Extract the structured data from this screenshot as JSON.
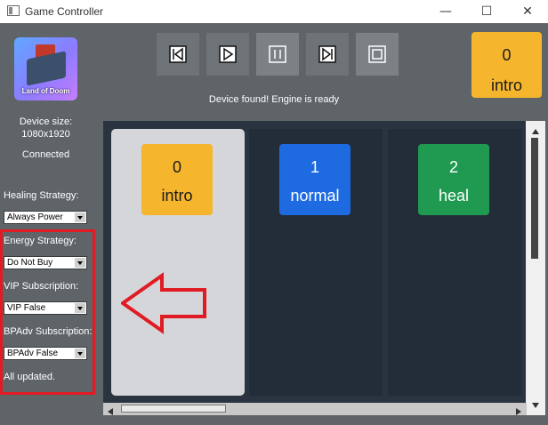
{
  "window": {
    "title": "Game Controller",
    "minimize_glyph": "—",
    "maximize_glyph": "☐",
    "close_glyph": "✕"
  },
  "logo": {
    "text": "Land of Doom",
    "icon": "game-logo"
  },
  "controls": [
    {
      "name": "skip-to-start-button",
      "icon": "skip-back-icon",
      "enabled": true
    },
    {
      "name": "play-button",
      "icon": "play-icon",
      "enabled": true
    },
    {
      "name": "pause-button",
      "icon": "pause-icon",
      "enabled": false
    },
    {
      "name": "skip-to-end-button",
      "icon": "skip-forward-icon",
      "enabled": true
    },
    {
      "name": "stop-button",
      "icon": "stop-icon",
      "enabled": false
    }
  ],
  "status": "Device found! Engine is ready",
  "current_strategy": {
    "number": "0",
    "label": "intro",
    "color": "#f5b62e"
  },
  "device": {
    "size_label": "Device size:",
    "size_value": "1080x1920",
    "connection": "Connected"
  },
  "settings": {
    "healing": {
      "label": "Healing Strategy:",
      "value": "Always Power"
    },
    "energy": {
      "label": "Energy Strategy:",
      "value": "Do Not Buy"
    },
    "vip": {
      "label": "VIP Subscription:",
      "value": "VIP False"
    },
    "bpadv": {
      "label": "BPAdv Subscription:",
      "value": "BPAdv False"
    }
  },
  "update_status": "All updated.",
  "strategies": [
    {
      "number": "0",
      "label": "intro",
      "color": "#f5b62e",
      "text_color": "#1a1a1a",
      "selected": true
    },
    {
      "number": "1",
      "label": "normal",
      "color": "#1e6ae0",
      "text_color": "#ffffff",
      "selected": false
    },
    {
      "number": "2",
      "label": "heal",
      "color": "#1f9a50",
      "text_color": "#ffffff",
      "selected": false
    }
  ],
  "colors": {
    "background": "#5f6469",
    "board": "#2a3340",
    "highlight": "#e11b23"
  }
}
